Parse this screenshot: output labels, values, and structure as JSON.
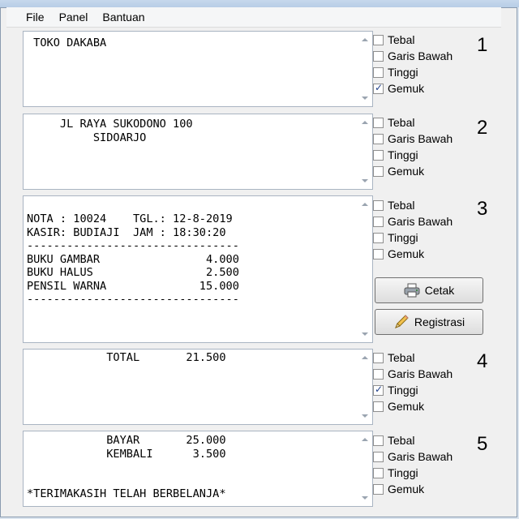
{
  "menubar": {
    "items": [
      "File",
      "Panel",
      "Bantuan"
    ]
  },
  "sections": [
    {
      "number": "1",
      "text": " TOKO DAKABA",
      "options": [
        {
          "label": "Tebal",
          "checked": false
        },
        {
          "label": "Garis Bawah",
          "checked": false
        },
        {
          "label": "Tinggi",
          "checked": false
        },
        {
          "label": "Gemuk",
          "checked": true
        }
      ]
    },
    {
      "number": "2",
      "text": "     JL RAYA SUKODONO 100\n          SIDOARJO",
      "options": [
        {
          "label": "Tebal",
          "checked": false
        },
        {
          "label": "Garis Bawah",
          "checked": false
        },
        {
          "label": "Tinggi",
          "checked": false
        },
        {
          "label": "Gemuk",
          "checked": false
        }
      ]
    },
    {
      "number": "3",
      "text": "NOTA : 10024    TGL.: 12-8-2019\nKASIR: BUDIAJI  JAM : 18:30:20\n--------------------------------\nBUKU GAMBAR                4.000\nBUKU HALUS                 2.500\nPENSIL WARNA              15.000\n--------------------------------",
      "options": [
        {
          "label": "Tebal",
          "checked": false
        },
        {
          "label": "Garis Bawah",
          "checked": false
        },
        {
          "label": "Tinggi",
          "checked": false
        },
        {
          "label": "Gemuk",
          "checked": false
        }
      ]
    },
    {
      "number": "4",
      "text": "            TOTAL       21.500",
      "options": [
        {
          "label": "Tebal",
          "checked": false
        },
        {
          "label": "Garis Bawah",
          "checked": false
        },
        {
          "label": "Tinggi",
          "checked": true
        },
        {
          "label": "Gemuk",
          "checked": false
        }
      ]
    },
    {
      "number": "5",
      "text": "            BAYAR       25.000\n            KEMBALI      3.500\n\n\n*TERIMAKASIH TELAH BERBELANJA*",
      "options": [
        {
          "label": "Tebal",
          "checked": false
        },
        {
          "label": "Garis Bawah",
          "checked": false
        },
        {
          "label": "Tinggi",
          "checked": false
        },
        {
          "label": "Gemuk",
          "checked": false
        }
      ]
    }
  ],
  "buttons": {
    "print_label": "Cetak",
    "register_label": "Registrasi"
  },
  "icons": {
    "print": "printer-icon",
    "register": "pencil-icon"
  }
}
